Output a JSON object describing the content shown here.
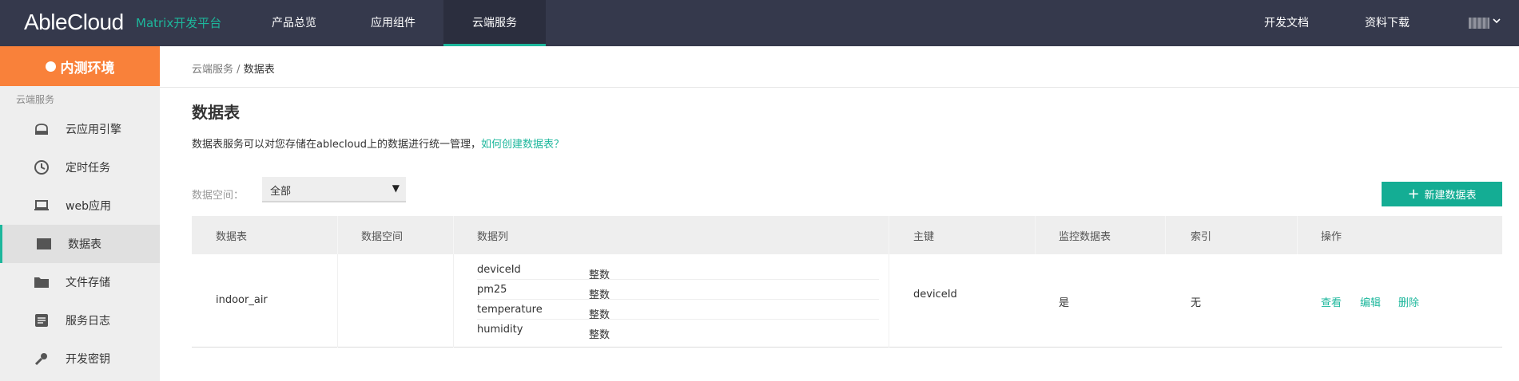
{
  "brand": {
    "logo": "AbleCloud",
    "platform": "Matrix开发平台"
  },
  "topnav": {
    "items": [
      {
        "label": "产品总览",
        "active": false
      },
      {
        "label": "应用组件",
        "active": false
      },
      {
        "label": "云端服务",
        "active": true
      }
    ],
    "right": [
      "开发文档",
      "资料下载"
    ]
  },
  "sidebar": {
    "env_label": "内测环境",
    "section": "云端服务",
    "items": [
      {
        "label": "云应用引擎",
        "icon": "cloud-engine-icon"
      },
      {
        "label": "定时任务",
        "icon": "clock-icon"
      },
      {
        "label": "web应用",
        "icon": "laptop-icon"
      },
      {
        "label": "数据表",
        "icon": "table-icon",
        "active": true
      },
      {
        "label": "文件存储",
        "icon": "folder-icon"
      },
      {
        "label": "服务日志",
        "icon": "log-icon"
      },
      {
        "label": "开发密钥",
        "icon": "key-icon"
      }
    ]
  },
  "breadcrumb": {
    "parent": "云端服务",
    "separator": "/",
    "current": "数据表"
  },
  "page": {
    "title": "数据表",
    "description": "数据表服务可以对您存储在ablecloud上的数据进行统一管理，",
    "help_link": "如何创建数据表？"
  },
  "filter": {
    "label": "数据空间：",
    "selected": "全部"
  },
  "new_button": "新建数据表",
  "table": {
    "headers": [
      "数据表",
      "数据空间",
      "数据列",
      "主键",
      "监控数据表",
      "索引",
      "操作"
    ],
    "rows": [
      {
        "name": "indoor_air",
        "space": "",
        "columns": [
          {
            "name": "deviceId",
            "type": "整数"
          },
          {
            "name": "pm25",
            "type": "整数"
          },
          {
            "name": "temperature",
            "type": "整数"
          },
          {
            "name": "humidity",
            "type": "整数"
          }
        ],
        "primary_key": "deviceId",
        "monitor": "是",
        "index": "无",
        "actions": [
          "查看",
          "编辑",
          "删除"
        ]
      }
    ]
  },
  "colors": {
    "nav_bg": "#35394c",
    "accent": "#1db79c",
    "env_orange": "#f9813a",
    "button": "#14ad94"
  }
}
